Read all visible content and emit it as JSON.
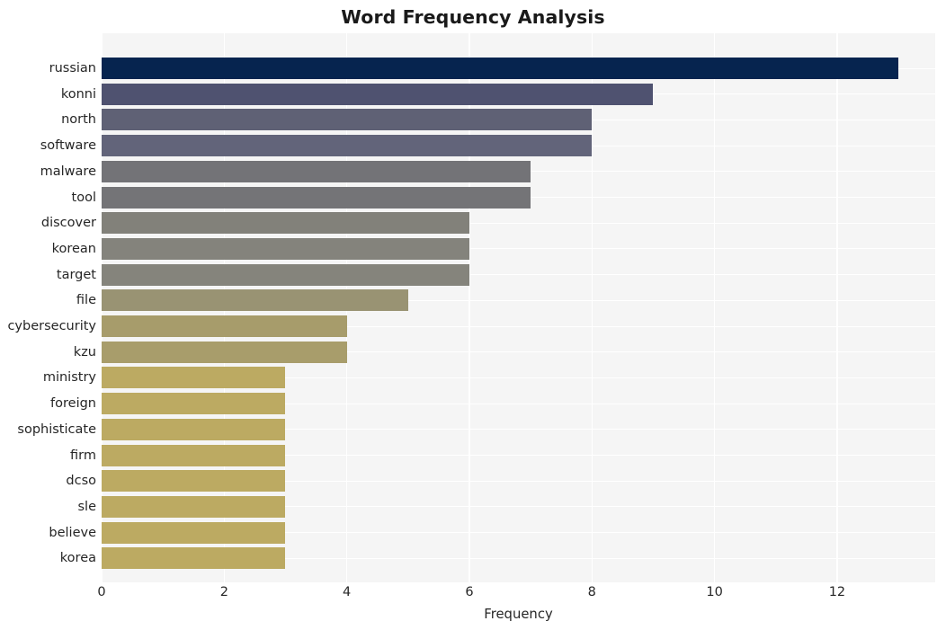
{
  "chart": {
    "title": "Word Frequency Analysis",
    "xlabel": "Frequency",
    "ylabel": ""
  },
  "chart_data": {
    "type": "bar",
    "orientation": "horizontal",
    "title": "Word Frequency Analysis",
    "xlabel": "Frequency",
    "ylabel": "",
    "xlim": [
      0,
      13.6
    ],
    "xticks": [
      0,
      2,
      4,
      6,
      8,
      10,
      12
    ],
    "xtick_labels": [
      "0",
      "2",
      "4",
      "6",
      "8",
      "10",
      "12"
    ],
    "grid": true,
    "legend": false,
    "colormap": "cividis",
    "categories": [
      "russian",
      "konni",
      "north",
      "software",
      "malware",
      "tool",
      "discover",
      "korean",
      "target",
      "file",
      "cybersecurity",
      "kzu",
      "ministry",
      "foreign",
      "sophisticate",
      "firm",
      "dcso",
      "sle",
      "believe",
      "korea"
    ],
    "values": [
      13,
      9,
      8,
      8,
      7,
      7,
      6,
      6,
      6,
      5,
      4,
      4,
      3,
      3,
      3,
      3,
      3,
      3,
      3,
      3
    ],
    "bar_colors": [
      "#06244f",
      "#4f5270",
      "#5f6175",
      "#62647a",
      "#737377",
      "#747477",
      "#82817a",
      "#84837c",
      "#85847c",
      "#999373",
      "#a79c6b",
      "#a89d6b",
      "#bcaa62",
      "#bcaa62",
      "#bcaa62",
      "#bcaa62",
      "#bcaa62",
      "#bcaa62",
      "#bcaa62",
      "#bcaa62"
    ],
    "bars": [
      {
        "label": "russian",
        "value": 13,
        "color": "#06244f"
      },
      {
        "label": "konni",
        "value": 9,
        "color": "#4f5270"
      },
      {
        "label": "north",
        "value": 8,
        "color": "#5f6175"
      },
      {
        "label": "software",
        "value": 8,
        "color": "#62647a"
      },
      {
        "label": "malware",
        "value": 7,
        "color": "#737377"
      },
      {
        "label": "tool",
        "value": 7,
        "color": "#747477"
      },
      {
        "label": "discover",
        "value": 6,
        "color": "#82817a"
      },
      {
        "label": "korean",
        "value": 6,
        "color": "#84837c"
      },
      {
        "label": "target",
        "value": 6,
        "color": "#85847c"
      },
      {
        "label": "file",
        "value": 5,
        "color": "#999373"
      },
      {
        "label": "cybersecurity",
        "value": 4,
        "color": "#a79c6b"
      },
      {
        "label": "kzu",
        "value": 4,
        "color": "#a89d6b"
      },
      {
        "label": "ministry",
        "value": 3,
        "color": "#bcaa62"
      },
      {
        "label": "foreign",
        "value": 3,
        "color": "#bcaa62"
      },
      {
        "label": "sophisticate",
        "value": 3,
        "color": "#bcaa62"
      },
      {
        "label": "firm",
        "value": 3,
        "color": "#bcaa62"
      },
      {
        "label": "dcso",
        "value": 3,
        "color": "#bcaa62"
      },
      {
        "label": "sle",
        "value": 3,
        "color": "#bcaa62"
      },
      {
        "label": "believe",
        "value": 3,
        "color": "#bcaa62"
      },
      {
        "label": "korea",
        "value": 3,
        "color": "#bcaa62"
      }
    ]
  },
  "style": {
    "figure_background": "#ffffff",
    "plot_background": "#f5f5f5",
    "gridline_color": "#ffffff",
    "text_color": "#262626",
    "title_color": "#1a1a1a"
  }
}
